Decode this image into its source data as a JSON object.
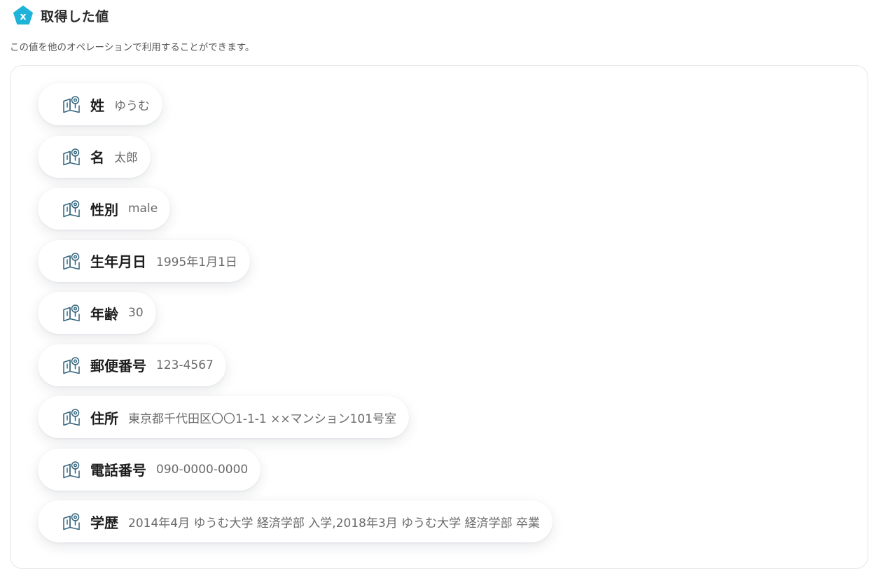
{
  "header": {
    "title": "取得した値",
    "description": "この値を他のオペレーションで利用することができます。"
  },
  "fields": [
    {
      "label": "姓",
      "value": "ゆうむ"
    },
    {
      "label": "名",
      "value": "太郎"
    },
    {
      "label": "性別",
      "value": "male"
    },
    {
      "label": "生年月日",
      "value": "1995年1月1日"
    },
    {
      "label": "年齢",
      "value": "30"
    },
    {
      "label": "郵便番号",
      "value": "123-4567"
    },
    {
      "label": "住所",
      "value": "東京都千代田区〇〇1-1-1 ××マンション101号室"
    },
    {
      "label": "電話番号",
      "value": "090-0000-0000"
    },
    {
      "label": "学歴",
      "value": "2014年4月 ゆうむ大学 経済学部 入学,2018年3月 ゆうむ大学 経済学部 卒業"
    }
  ],
  "colors": {
    "brand": "#1fb3d9",
    "icon_stroke": "#35657d"
  },
  "icons": {
    "brand": "x-variable-pentagon-icon",
    "field": "book-eye-icon"
  }
}
